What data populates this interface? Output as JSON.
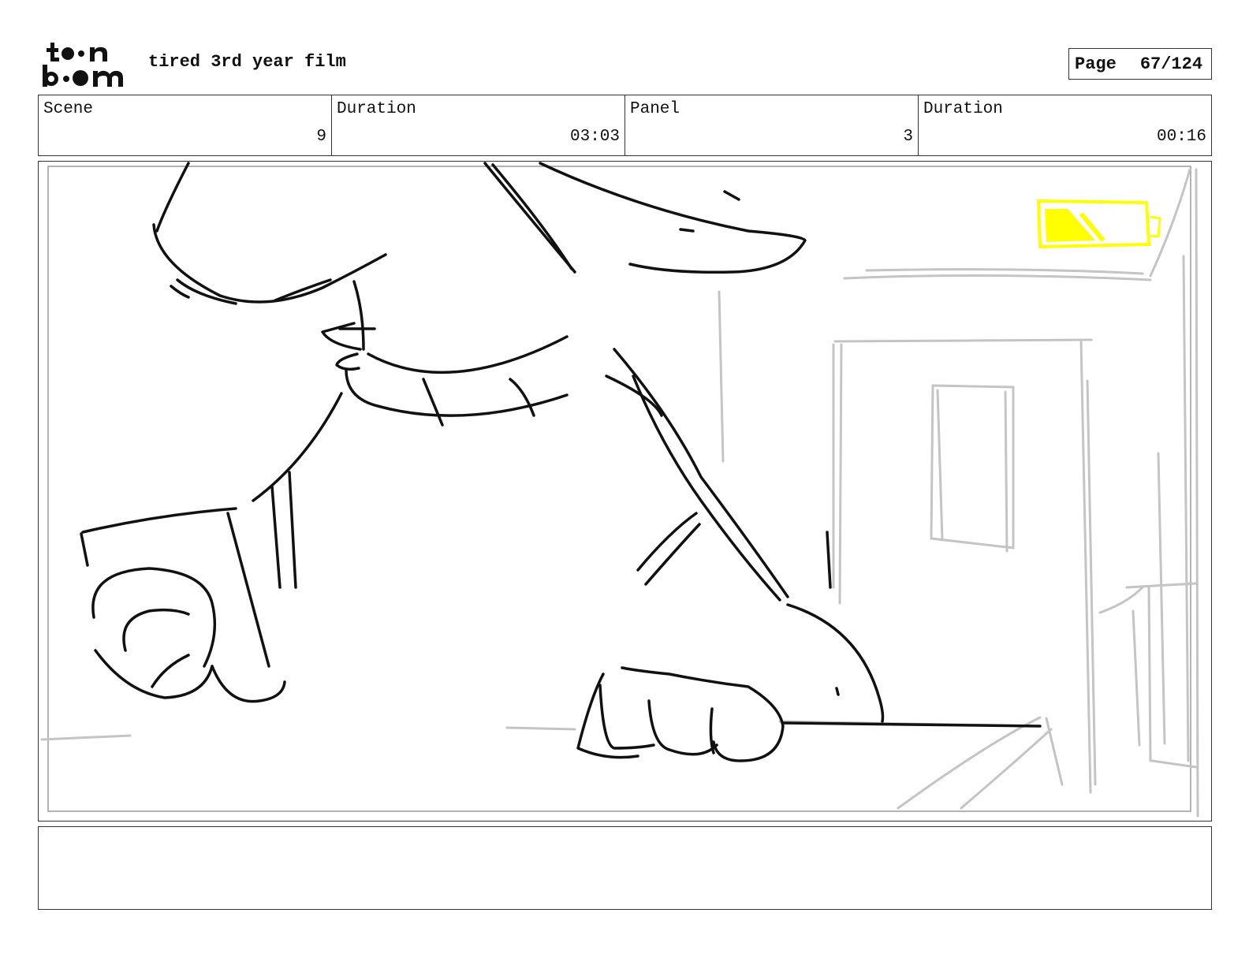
{
  "header": {
    "logo_text": "toon boom",
    "film_title": "tired 3rd year film",
    "page_label": "Page",
    "page_number": "67/124"
  },
  "info": [
    {
      "label": "Scene",
      "value": "9"
    },
    {
      "label": "Duration",
      "value": "03:03"
    },
    {
      "label": "Panel",
      "value": "3"
    },
    {
      "label": "Duration",
      "value": "00:16"
    }
  ],
  "colors": {
    "ink": "#111111",
    "rough_sketch": "#bdbdbd",
    "highlight": "#ffff00"
  },
  "notes": {
    "text": ""
  }
}
